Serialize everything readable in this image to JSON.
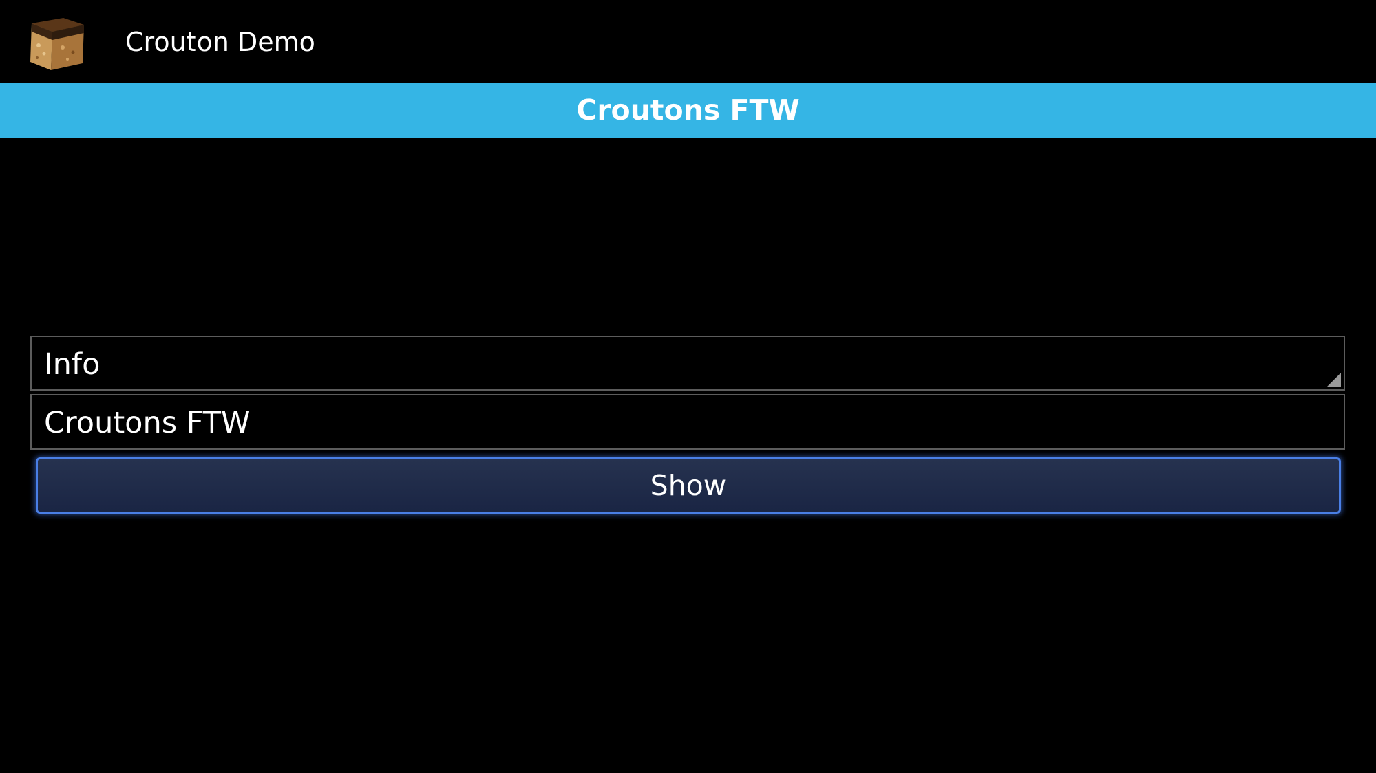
{
  "action_bar": {
    "title": "Crouton Demo",
    "icon": "crouton-cube-icon"
  },
  "crouton": {
    "message": "Croutons FTW",
    "style": "info",
    "background": "#35b5e5"
  },
  "form": {
    "style_spinner": {
      "selected": "Info"
    },
    "message_input": {
      "value": "Croutons FTW"
    },
    "show_button_label": "Show"
  }
}
